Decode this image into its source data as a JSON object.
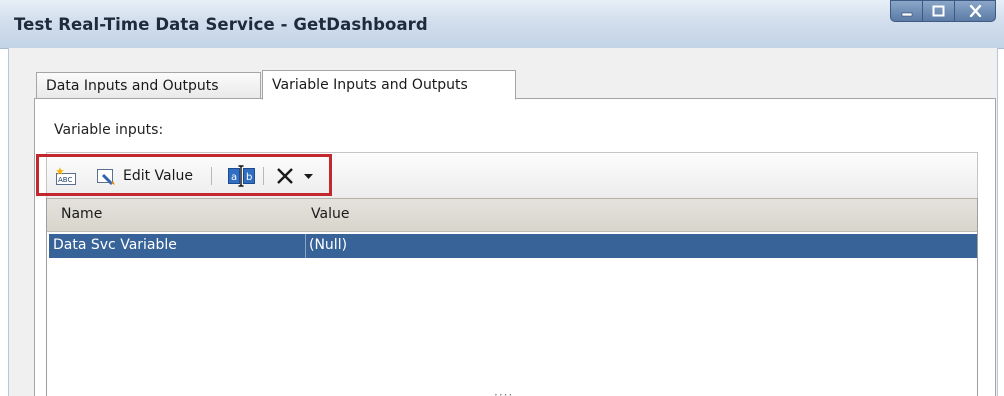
{
  "window": {
    "title": "Test Real-Time Data Service - GetDashboard",
    "controls": {
      "minimize": "minimize",
      "maximize": "maximize",
      "close": "close"
    }
  },
  "tabs": [
    {
      "label": "Data Inputs and Outputs",
      "selected": false
    },
    {
      "label": "Variable Inputs and Outputs",
      "selected": true
    }
  ],
  "variables_section": {
    "label": "Variable inputs:"
  },
  "toolbar": {
    "edit_value_label": "Edit Value",
    "icons": [
      "new-variable-icon",
      "edit-value-icon",
      "rename-icon",
      "delete-icon",
      "dropdown-arrow-icon"
    ]
  },
  "table": {
    "columns": [
      "Name",
      "Value"
    ],
    "rows": [
      {
        "name": "Data Svc Variable",
        "value": "(Null)",
        "selected": true
      }
    ]
  },
  "colors": {
    "selection": "#386398",
    "highlight_frame": "#c2282d"
  }
}
